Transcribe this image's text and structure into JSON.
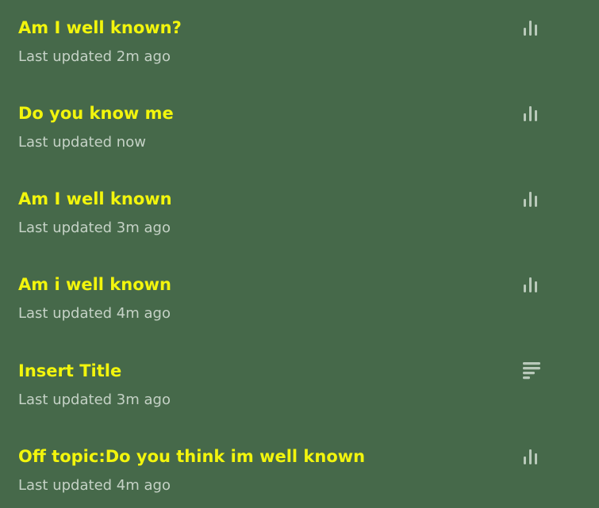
{
  "items": [
    {
      "title": "Am I well known?",
      "subtitle": "Last updated 2m ago",
      "icon": "bar-chart-icon"
    },
    {
      "title": "Do you know me",
      "subtitle": "Last updated now",
      "icon": "bar-chart-icon"
    },
    {
      "title": "Am I well known",
      "subtitle": "Last updated 3m ago",
      "icon": "bar-chart-icon"
    },
    {
      "title": "Am i well known",
      "subtitle": "Last updated 4m ago",
      "icon": "bar-chart-icon"
    },
    {
      "title": "Insert Title",
      "subtitle": "Last updated 3m ago",
      "icon": "text-lines-icon"
    },
    {
      "title": "Off topic:Do you think im well known",
      "subtitle": "Last updated 4m ago",
      "icon": "bar-chart-icon"
    }
  ],
  "colors": {
    "background": "#46694a",
    "title": "#f2f50d",
    "subtitle": "#c5d2c6",
    "icon": "#b9c9ba"
  }
}
